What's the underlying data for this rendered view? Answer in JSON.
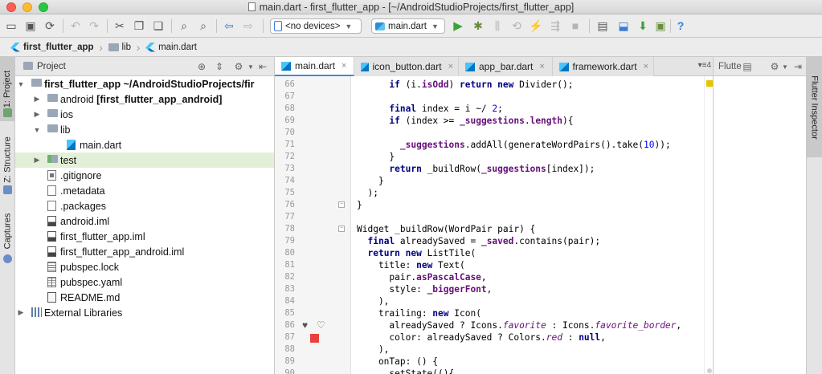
{
  "window": {
    "title": "main.dart - first_flutter_app - [~/AndroidStudioProjects/first_flutter_app]"
  },
  "toolbar": {
    "device_combo": "<no devices>",
    "config_combo": "main.dart",
    "icons": [
      "folder-open-icon",
      "save-all-icon",
      "sync-icon",
      "undo-icon",
      "redo-icon",
      "cut-icon",
      "copy-icon",
      "paste-icon",
      "find-icon",
      "replace-icon",
      "back-icon",
      "forward-icon",
      "run-icon",
      "debug-icon",
      "profile-icon",
      "attach-icon",
      "stop-icon",
      "sdk-manager-icon",
      "avd-manager-icon",
      "sync-gradle-icon",
      "help-icon"
    ]
  },
  "breadcrumb": {
    "items": [
      "first_flutter_app",
      "lib",
      "main.dart"
    ]
  },
  "left_strip": {
    "tabs": [
      "1: Project",
      "Z: Structure",
      "Captures"
    ]
  },
  "right_strip": {
    "tabs": [
      "Flutter Inspector"
    ]
  },
  "project_panel": {
    "title": "Project",
    "tree": [
      {
        "label": "first_flutter_app",
        "suffix": " ~/AndroidStudioProjects/fir",
        "level": 0,
        "expanded": true,
        "icon": "project"
      },
      {
        "label": "android",
        "suffix": " [first_flutter_app_android]",
        "level": 1,
        "expanded": false,
        "icon": "folder"
      },
      {
        "label": "ios",
        "suffix": "",
        "level": 1,
        "expanded": false,
        "icon": "folder"
      },
      {
        "label": "lib",
        "suffix": "",
        "level": 1,
        "expanded": true,
        "icon": "folder"
      },
      {
        "label": "main.dart",
        "suffix": "",
        "level": 2,
        "icon": "dart"
      },
      {
        "label": "test",
        "suffix": "",
        "level": 1,
        "expanded": false,
        "icon": "test-folder",
        "selected": true
      },
      {
        "label": ".gitignore",
        "suffix": "",
        "level": 1,
        "icon": "git"
      },
      {
        "label": ".metadata",
        "suffix": "",
        "level": 1,
        "icon": "file"
      },
      {
        "label": ".packages",
        "suffix": "",
        "level": 1,
        "icon": "file"
      },
      {
        "label": "android.iml",
        "suffix": "",
        "level": 1,
        "icon": "iml"
      },
      {
        "label": "first_flutter_app.iml",
        "suffix": "",
        "level": 1,
        "icon": "iml"
      },
      {
        "label": "first_flutter_app_android.iml",
        "suffix": "",
        "level": 1,
        "icon": "iml"
      },
      {
        "label": "pubspec.lock",
        "suffix": "",
        "level": 1,
        "icon": "lock"
      },
      {
        "label": "pubspec.yaml",
        "suffix": "",
        "level": 1,
        "icon": "yaml"
      },
      {
        "label": "README.md",
        "suffix": "",
        "level": 1,
        "icon": "md"
      },
      {
        "label": "External Libraries",
        "suffix": "",
        "level": 0,
        "expanded": false,
        "icon": "libs"
      }
    ]
  },
  "editor": {
    "tabs": [
      {
        "label": "main.dart",
        "active": true
      },
      {
        "label": "icon_button.dart",
        "active": false
      },
      {
        "label": "app_bar.dart",
        "active": false
      },
      {
        "label": "framework.dart",
        "active": false
      }
    ],
    "tab_overflow": "4",
    "lines": [
      {
        "n": "66",
        "html": "      <span class=\"kw\">if</span> (i.<span class=\"fld\">isOdd</span>) <span class=\"kw\">return new</span> Divider();"
      },
      {
        "n": "67",
        "html": ""
      },
      {
        "n": "68",
        "html": "      <span class=\"kw\">final</span> index = i ~/ <span class=\"num\">2</span>;"
      },
      {
        "n": "69",
        "html": "      <span class=\"kw\">if</span> (index >= <span class=\"fld\">_suggestions</span>.<span class=\"fld\">length</span>){"
      },
      {
        "n": "70",
        "html": ""
      },
      {
        "n": "71",
        "html": "        <span class=\"fld\">_suggestions</span>.addAll(generateWordPairs().take(<span class=\"num\">10</span>));"
      },
      {
        "n": "72",
        "html": "      }"
      },
      {
        "n": "73",
        "html": "      <span class=\"kw\">return</span> _buildRow(<span class=\"fld\">_suggestions</span>[index]);"
      },
      {
        "n": "74",
        "html": "    }"
      },
      {
        "n": "75",
        "html": "  );"
      },
      {
        "n": "76",
        "html": "}"
      },
      {
        "n": "77",
        "html": ""
      },
      {
        "n": "78",
        "html": "Widget _buildRow(WordPair pair) {"
      },
      {
        "n": "79",
        "html": "  <span class=\"kw\">final</span> alreadySaved = <span class=\"fld\">_saved</span>.contains(pair);"
      },
      {
        "n": "80",
        "html": "  <span class=\"kw\">return new</span> ListTile("
      },
      {
        "n": "81",
        "html": "    title: <span class=\"kw\">new</span> Text("
      },
      {
        "n": "82",
        "html": "      pair.<span class=\"fld\">asPascalCase</span>,"
      },
      {
        "n": "83",
        "html": "      style: <span class=\"fld\">_biggerFont</span>,"
      },
      {
        "n": "84",
        "html": "    ),"
      },
      {
        "n": "85",
        "html": "    trailing: <span class=\"kw\">new</span> Icon("
      },
      {
        "n": "86",
        "html": "      alreadySaved ? Icons.<span class=\"it\">favorite</span> : Icons.<span class=\"it\">favorite_border</span>,"
      },
      {
        "n": "87",
        "html": "      color: alreadySaved ? Colors.<span class=\"it\">red</span> : <span class=\"kw\">null</span>,"
      },
      {
        "n": "88",
        "html": "    ),"
      },
      {
        "n": "89",
        "html": "    onTap: () {"
      },
      {
        "n": "90",
        "html": "      setState((){"
      }
    ]
  },
  "flutter_panel": {
    "title": "Flutte"
  },
  "colors": {
    "accent": "#4a88d8",
    "selection": "#e4efd9",
    "keyword": "#000080",
    "field": "#660e7a",
    "number": "#0000ff"
  }
}
